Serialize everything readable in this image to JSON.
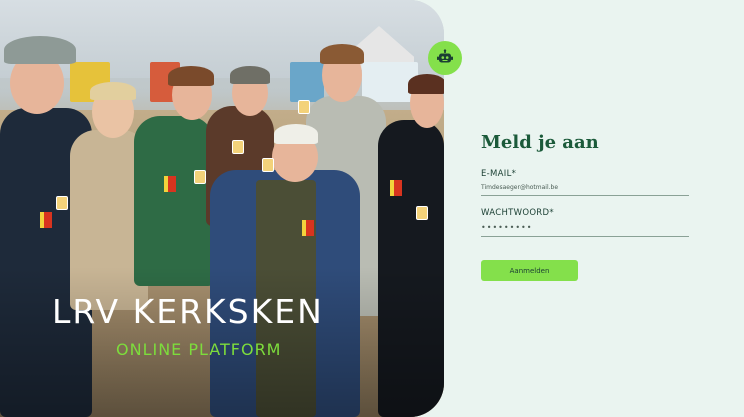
{
  "hero": {
    "title": "LRV KERKSKEN",
    "subtitle": "ONLINE PLATFORM"
  },
  "badge": {
    "icon": "robot-icon"
  },
  "login": {
    "title": "Meld je aan",
    "email_label": "E-MAIL*",
    "email_value": "Timdesaeger@hotmail.be",
    "password_label": "WACHTWOORD*",
    "password_value": "•••••••••",
    "submit_label": "Aanmelden"
  },
  "colors": {
    "accent": "#84e04b",
    "title_green": "#1b5a3a",
    "background": "#eaf4f0"
  }
}
